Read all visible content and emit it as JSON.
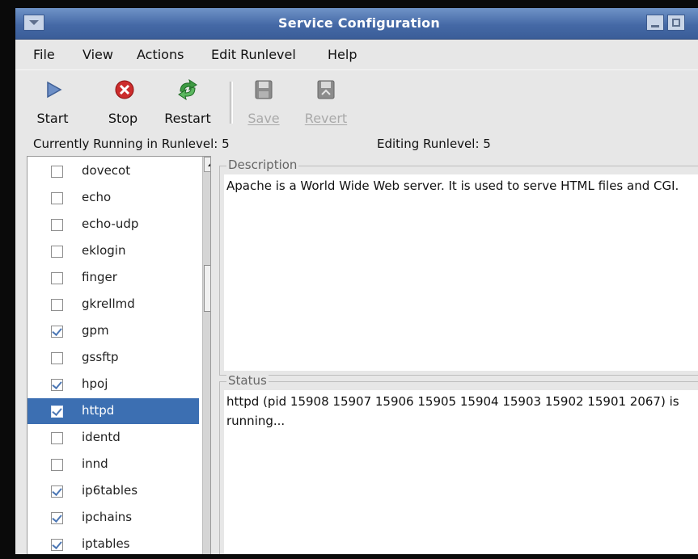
{
  "window": {
    "title": "Service Configuration"
  },
  "menu": [
    "File",
    "View",
    "Actions",
    "Edit Runlevel",
    "Help"
  ],
  "toolbar": {
    "start": "Start",
    "stop": "Stop",
    "restart": "Restart",
    "save": "Save",
    "revert": "Revert"
  },
  "status": {
    "running": "Currently Running in Runlevel: 5",
    "editing": "Editing Runlevel: 5"
  },
  "services": [
    {
      "name": "dovecot",
      "checked": false
    },
    {
      "name": "echo",
      "checked": false
    },
    {
      "name": "echo-udp",
      "checked": false
    },
    {
      "name": "eklogin",
      "checked": false
    },
    {
      "name": "finger",
      "checked": false
    },
    {
      "name": "gkrellmd",
      "checked": false
    },
    {
      "name": "gpm",
      "checked": true
    },
    {
      "name": "gssftp",
      "checked": false
    },
    {
      "name": "hpoj",
      "checked": true
    },
    {
      "name": "httpd",
      "checked": true,
      "selected": true
    },
    {
      "name": "identd",
      "checked": false
    },
    {
      "name": "innd",
      "checked": false
    },
    {
      "name": "ip6tables",
      "checked": true
    },
    {
      "name": "ipchains",
      "checked": true
    },
    {
      "name": "iptables",
      "checked": true
    }
  ],
  "description": {
    "label": "Description",
    "text": "Apache is a World Wide Web server.  It is used to serve HTML files and CGI."
  },
  "status_box": {
    "label": "Status",
    "text": "httpd (pid 15908 15907 15906 15905 15904 15903 15902 15901 2067) is running..."
  }
}
